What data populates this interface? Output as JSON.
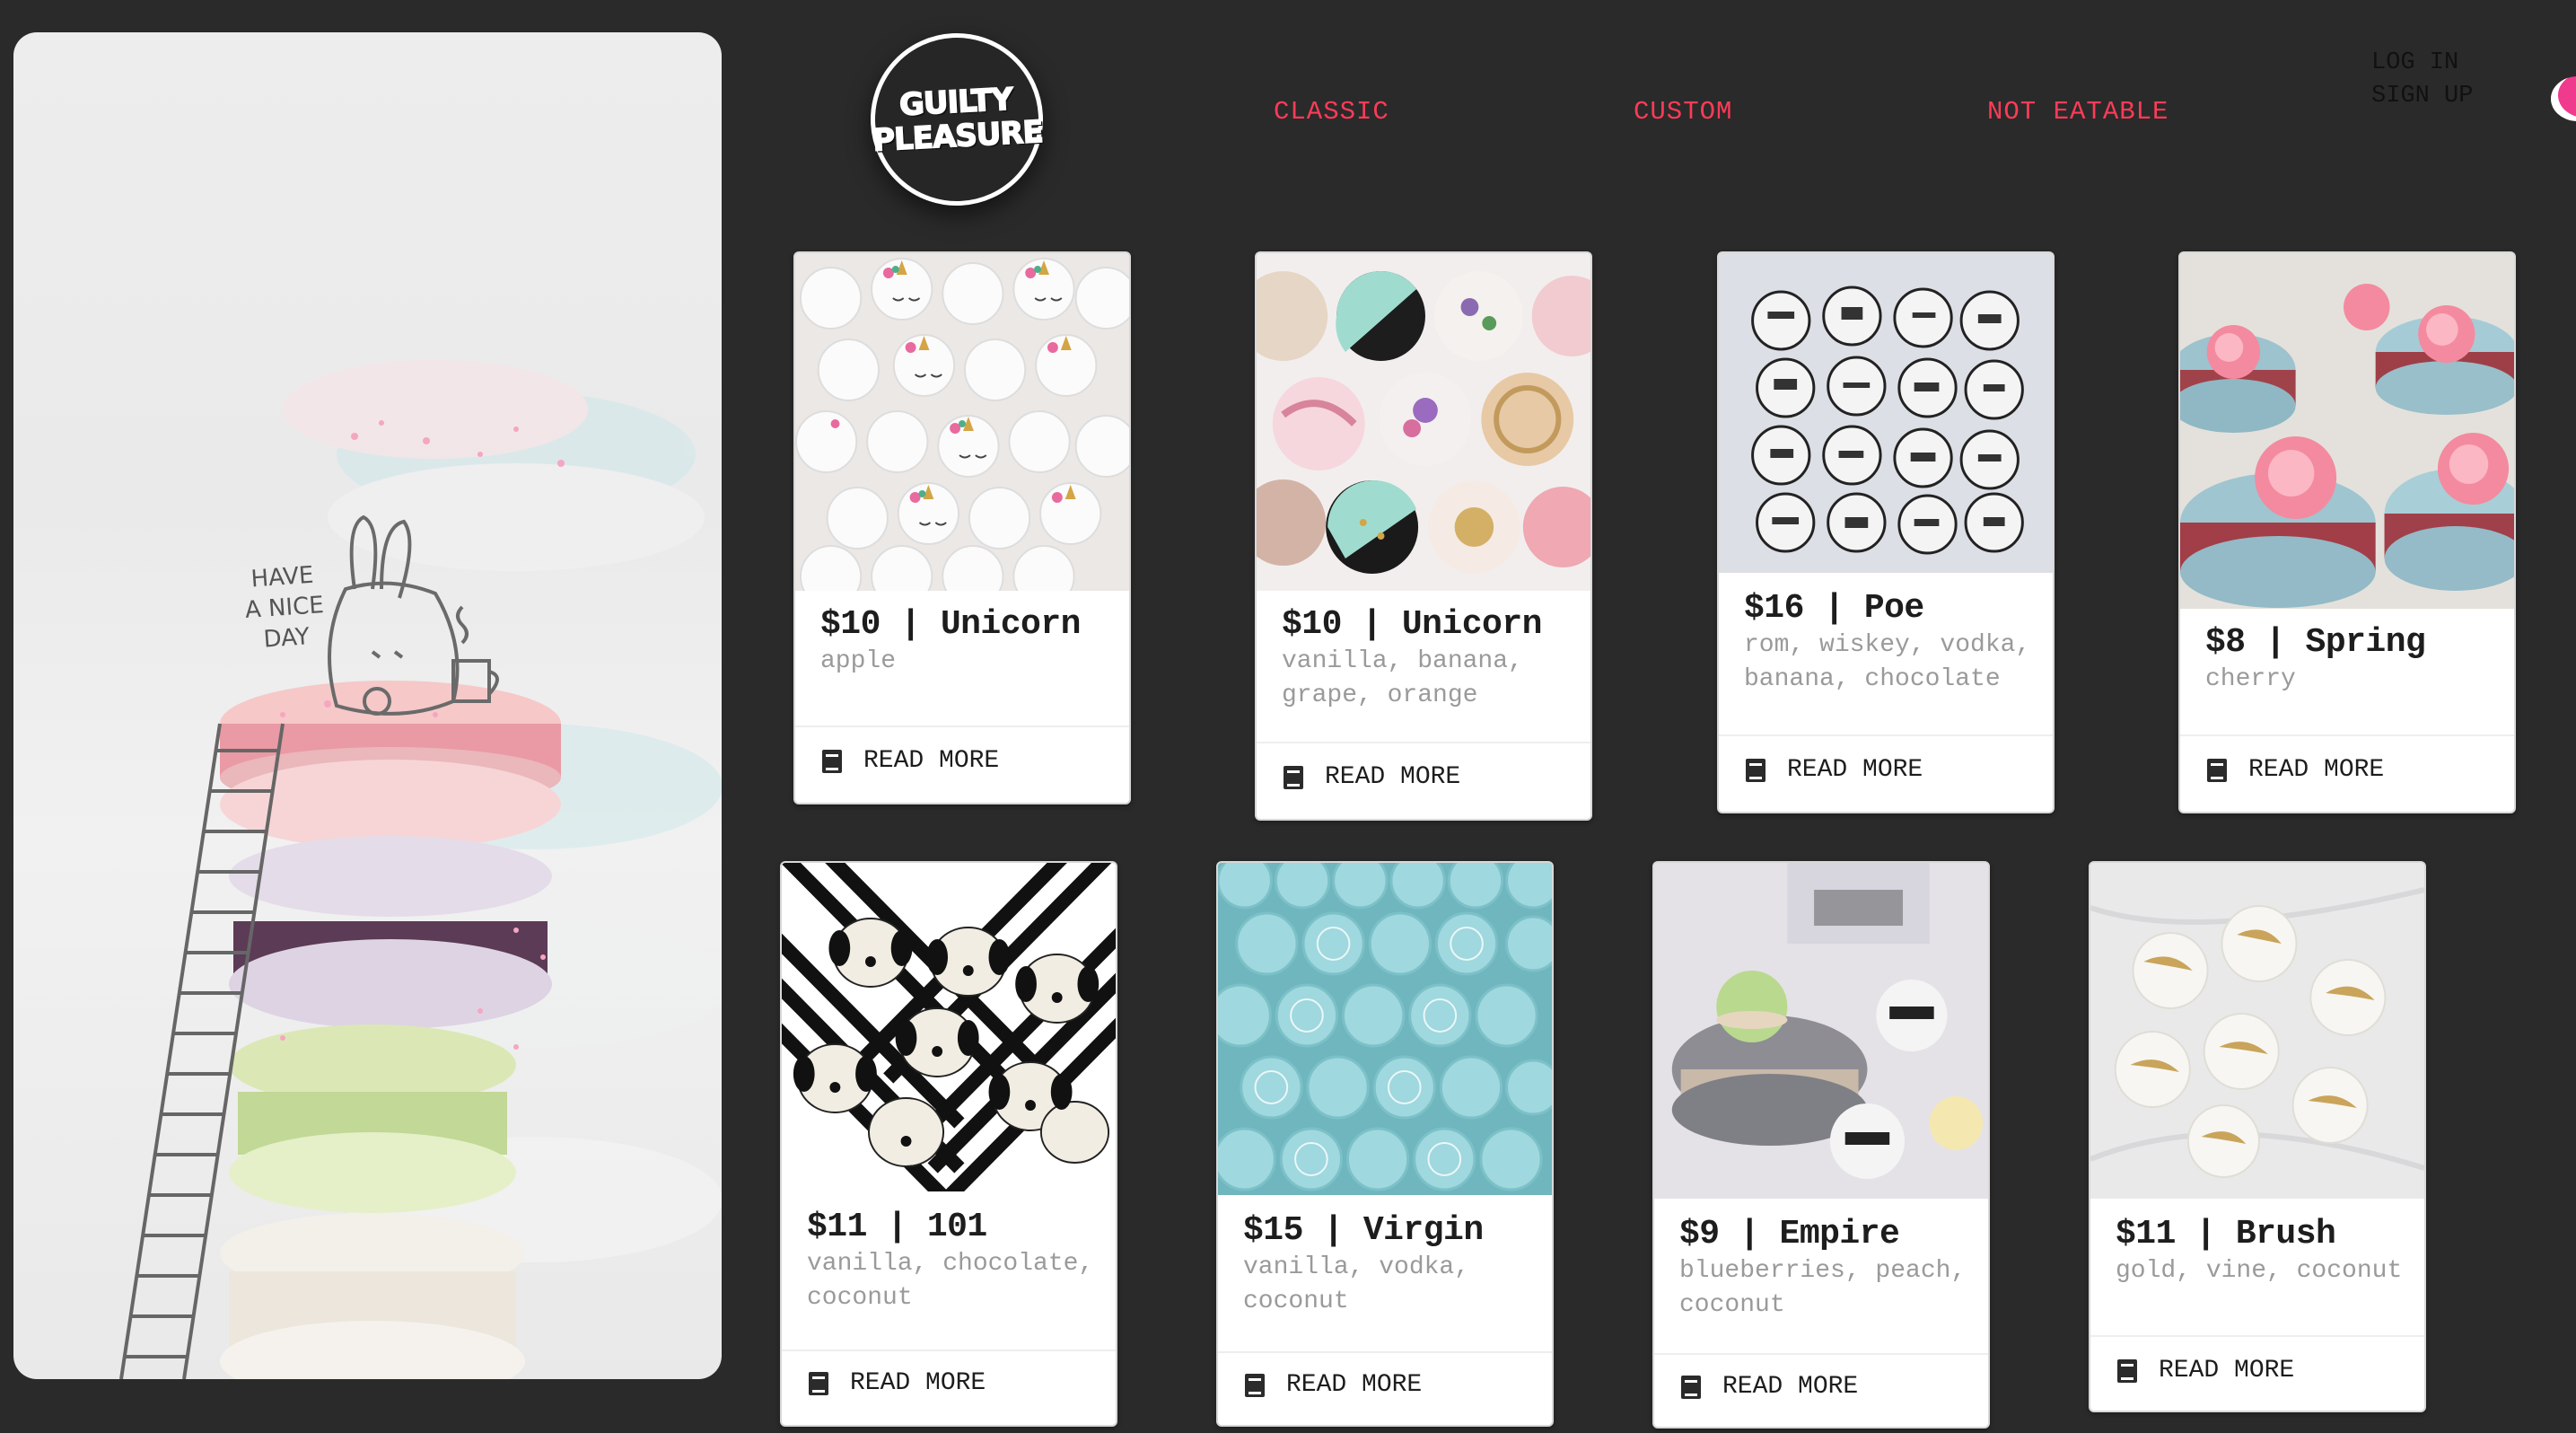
{
  "hero": {
    "doodle_text": [
      "HAVE",
      "A NICE",
      "DAY"
    ]
  },
  "logo": {
    "line1": "GUILTY",
    "line2": "PLEASURE"
  },
  "nav": {
    "classic": "CLASSIC",
    "custom": "CUSTOM",
    "not_eatable": "NOT EATABLE"
  },
  "auth": {
    "login": "LOG IN",
    "signup": "SIGN UP"
  },
  "colors": {
    "accent": "#ff3b57",
    "background": "#2a2a2a",
    "card": "#ffffff"
  },
  "cards": [
    {
      "title": "$10 | Unicorn",
      "desc": "apple",
      "action": "READ MORE",
      "image": "unicorn-macarons"
    },
    {
      "title": "$10 | Unicorn",
      "desc": "vanilla, banana, grape, orange",
      "action": "READ MORE",
      "image": "painted-macarons"
    },
    {
      "title": "$16 | Poe",
      "desc": "rom, wiskey, vodka, banana, chocolate",
      "action": "READ MORE",
      "image": "newspaper-macarons"
    },
    {
      "title": "$8 | Spring",
      "desc": "cherry",
      "action": "READ MORE",
      "image": "rose-macarons"
    },
    {
      "title": "$11 | 101",
      "desc": "vanilla, chocolate, coconut",
      "action": "READ MORE",
      "image": "dalmatian-macarons"
    },
    {
      "title": "$15 | Virgin",
      "desc": "vanilla, vodka, coconut",
      "action": "READ MORE",
      "image": "lace-macarons"
    },
    {
      "title": "$9 | Empire",
      "desc": "blueberries, peach, coconut",
      "action": "READ MORE",
      "image": "star-wars-macarons"
    },
    {
      "title": "$11 | Brush",
      "desc": "gold, vine, coconut",
      "action": "READ MORE",
      "image": "gold-brush-macarons"
    }
  ]
}
